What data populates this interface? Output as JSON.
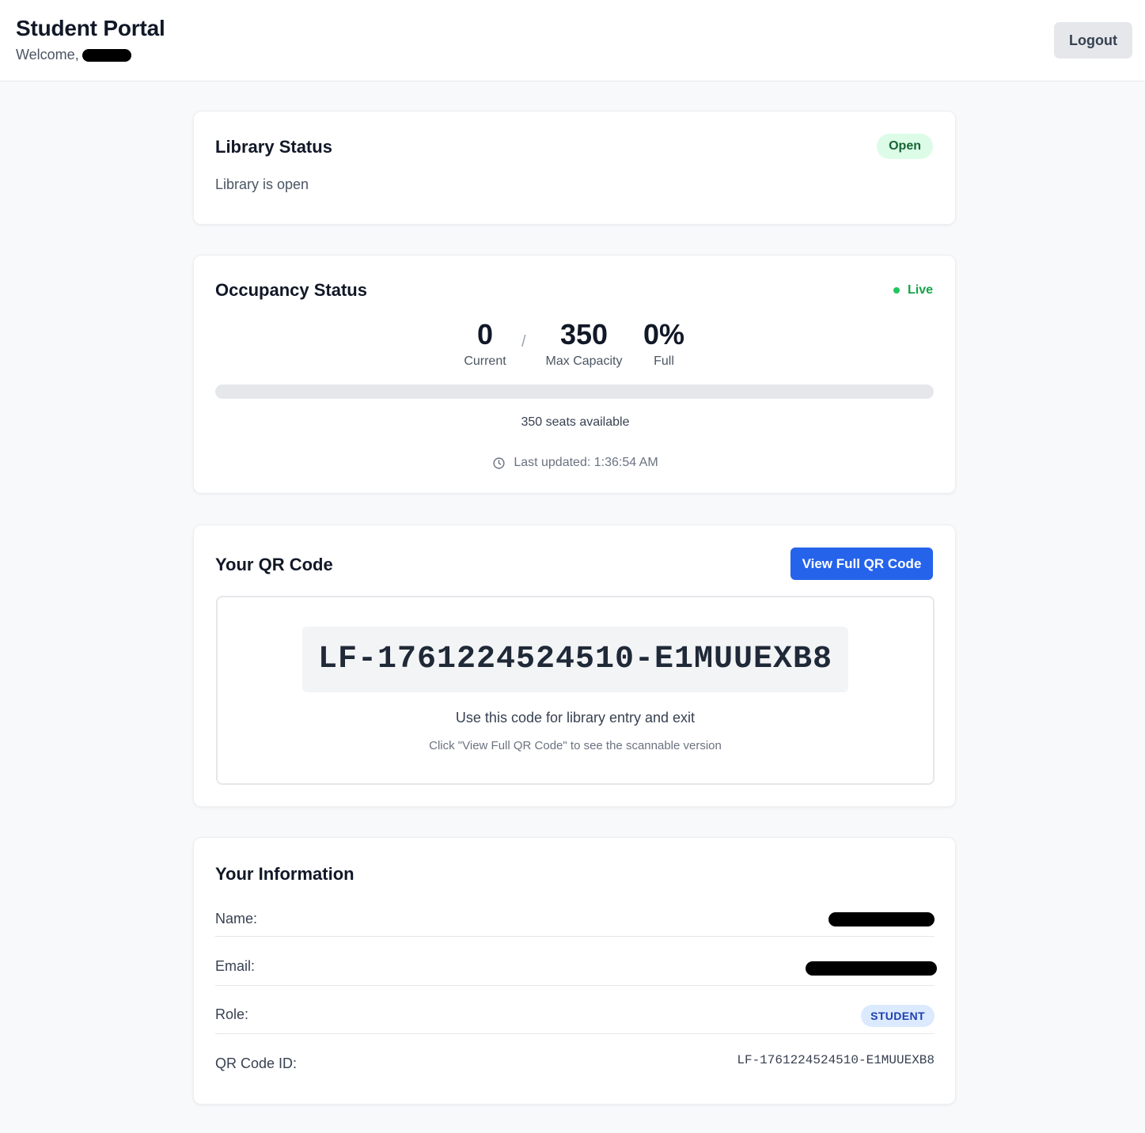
{
  "header": {
    "title": "Student Portal",
    "welcome_label": "Welcome,",
    "logout_label": "Logout"
  },
  "library": {
    "title": "Library Status",
    "badge": "Open",
    "message": "Library is open"
  },
  "occupancy": {
    "title": "Occupancy Status",
    "live_label": "Live",
    "current_value": "0",
    "current_label": "Current",
    "separator": "/",
    "max_value": "350",
    "max_label": "Max Capacity",
    "percent_value": "0%",
    "percent_label": "Full",
    "fill_fraction": 0,
    "seats_text": "350 seats available",
    "updated_text": "Last updated: 1:36:54 AM"
  },
  "qr": {
    "title": "Your QR Code",
    "view_button": "View Full QR Code",
    "code": "LF-1761224524510-E1MUUEXB8",
    "use_text": "Use this code for library entry and exit",
    "hint_text": "Click \"View Full QR Code\" to see the scannable version"
  },
  "info": {
    "title": "Your Information",
    "name_label": "Name:",
    "email_label": "Email:",
    "role_label": "Role:",
    "role_value": "STUDENT",
    "qr_label": "QR Code ID:",
    "qr_value": "LF-1761224524510-E1MUUEXB8"
  },
  "colors": {
    "primary": "#2563eb",
    "open_bg": "#dcfce7",
    "open_text": "#166534",
    "live": "#16a34a",
    "role_bg": "#dbeafe",
    "role_text": "#1e40af"
  },
  "icons": [
    "clock-icon",
    "live-dot-icon"
  ]
}
